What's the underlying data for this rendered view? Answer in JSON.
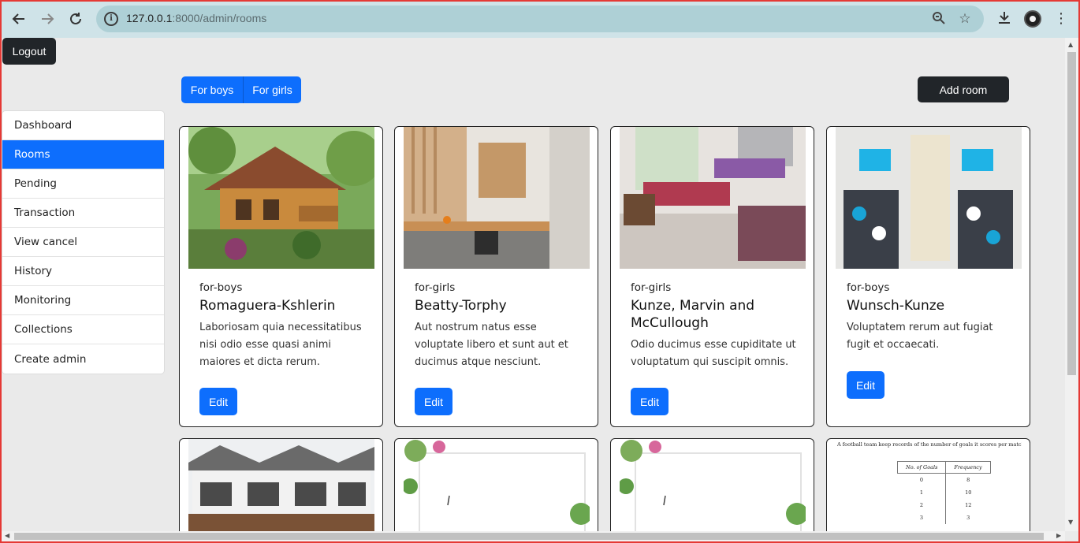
{
  "browser": {
    "url_host": "127.0.0.1",
    "url_path": ":8000/admin/rooms"
  },
  "header": {
    "logout_label": "Logout"
  },
  "sidebar": {
    "items": [
      {
        "label": "Dashboard"
      },
      {
        "label": "Rooms"
      },
      {
        "label": "Pending"
      },
      {
        "label": "Transaction"
      },
      {
        "label": "View cancel"
      },
      {
        "label": "History"
      },
      {
        "label": "Monitoring"
      },
      {
        "label": "Collections"
      },
      {
        "label": "Create admin"
      }
    ],
    "active_index": 1
  },
  "filters": {
    "boys_label": "For boys",
    "girls_label": "For girls"
  },
  "toolbar": {
    "add_room_label": "Add room"
  },
  "rooms": [
    {
      "category": "for-boys",
      "title": "Romaguera-Kshlerin",
      "description": "Laboriosam quia necessitatibus nisi odio esse quasi animi maiores et dicta rerum.",
      "edit_label": "Edit"
    },
    {
      "category": "for-girls",
      "title": "Beatty-Torphy",
      "description": "Aut nostrum natus esse voluptate libero et sunt aut et ducimus atque nesciunt.",
      "edit_label": "Edit"
    },
    {
      "category": "for-girls",
      "title": "Kunze, Marvin and McCullough",
      "description": "Odio ducimus esse cupiditate ut voluptatum qui suscipit omnis.",
      "edit_label": "Edit"
    },
    {
      "category": "for-boys",
      "title": "Wunsch-Kunze",
      "description": "Voluptatem rerum aut fugiat fugit et occaecati.",
      "edit_label": "Edit"
    }
  ],
  "second_row": {
    "table_caption": "A football team keep records of the number of goals it scores per match during a season",
    "table_headers": [
      "No. of Goals",
      "Frequency"
    ],
    "table_rows": [
      [
        "0",
        "8"
      ],
      [
        "1",
        "10"
      ],
      [
        "2",
        "12"
      ],
      [
        "3",
        "3"
      ]
    ]
  },
  "colors": {
    "primary": "#0d6efd",
    "dark": "#212529",
    "page_bg": "#eaeaea"
  }
}
